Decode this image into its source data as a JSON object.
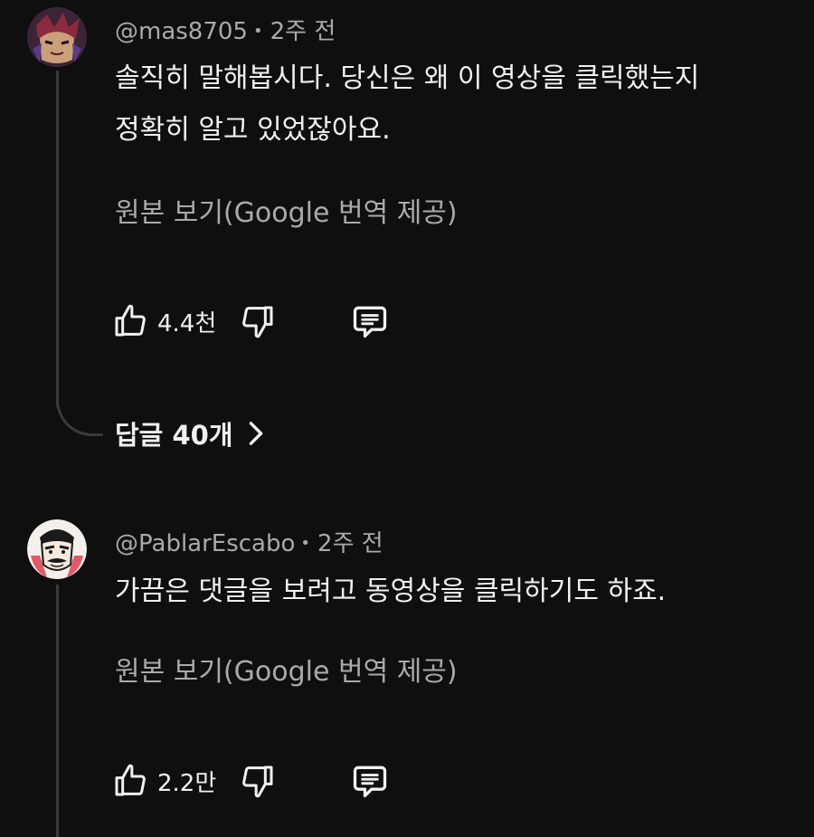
{
  "comments": [
    {
      "author": "@mas8705",
      "separator": "•",
      "time": "2주 전",
      "text_line1": "솔직히 말해봅시다. 당신은 왜 이 영상을 클릭했는지",
      "text_line2": "정확히 알고 있었잖아요.",
      "translate_label": "원본 보기(Google 번역 제공)",
      "likes": "4.4천",
      "replies_label": "답글 40개"
    },
    {
      "author": "@PablarEscabo",
      "separator": "•",
      "time": "2주 전",
      "text_line1": "가끔은 댓글을 보려고 동영상을 클릭하기도 하죠.",
      "translate_label": "원본 보기(Google 번역 제공)",
      "likes": "2.2만"
    }
  ],
  "colors": {
    "background": "#0f0f0f",
    "primary_text": "#f1f1f1",
    "secondary_text": "#aaaaaa",
    "thread_line": "#3a3a3a"
  },
  "icons": [
    "thumbs-up-icon",
    "thumbs-down-icon",
    "reply-comment-icon",
    "chevron-right-icon"
  ]
}
